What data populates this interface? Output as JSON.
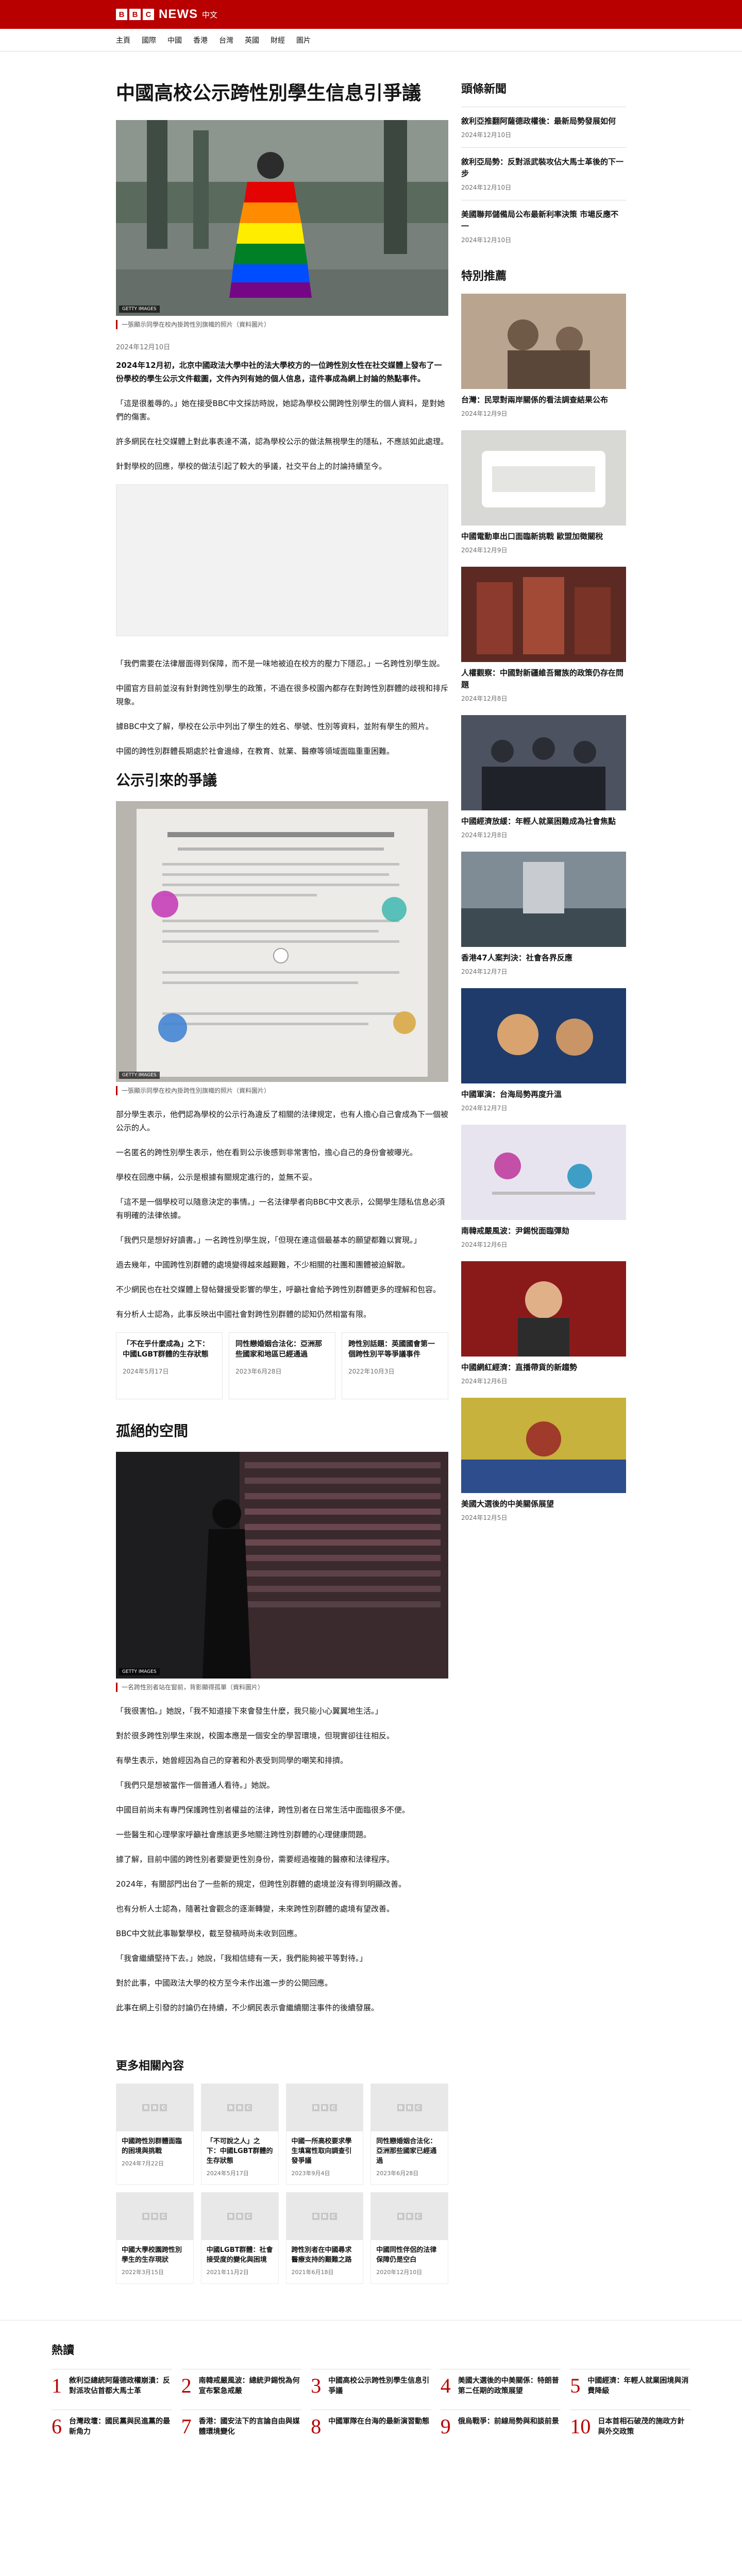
{
  "header": {
    "logo_letters": [
      "B",
      "B",
      "C"
    ],
    "news": "NEWS",
    "lang": "中文",
    "nav": [
      "主頁",
      "國際",
      "中國",
      "香港",
      "台灣",
      "英國",
      "財經",
      "圖片"
    ]
  },
  "article": {
    "title": "中國高校公示跨性別學生信息引爭議",
    "hero_caption": "一張顯示同學在校內掛跨性別旗幟的照片（資料圖片）",
    "byline": "2024年12月10日",
    "paragraphs": [
      "2024年12月初，北京中國政法大學中社的法大學校方的一位跨性別女性在社交媒體上發布了一份學校的學生公示文件截圖，文件內列有她的個人信息，這件事成為網上討論的熱點事件。",
      "「這是很羞辱的。」她在接受BBC中文採訪時說，她認為學校公開跨性別學生的個人資料，是對她們的傷害。",
      "許多網民在社交媒體上對此事表達不滿，認為學校公示的做法無視學生的隱私，不應該如此處理。",
      "針對學校的回應，學校的做法引起了較大的爭議，社交平台上的討論持續至今。",
      "「我們需要在法律層面得到保障，而不是一味地被迫在校方的壓力下隱忍。」一名跨性別學生說。",
      "中國官方目前並沒有針對跨性別學生的政策，不過在很多校園內都存在對跨性別群體的歧視和排斥現象。",
      "據BBC中文了解，學校在公示中列出了學生的姓名、學號、性別等資料，並附有學生的照片。",
      "中國的跨性別群體長期處於社會邊緣，在教育、就業、醫療等領域面臨重重困難。"
    ],
    "section_heading": "公示引來的爭議",
    "paragraphs2": [
      "部分學生表示，他們認為學校的公示行為違反了相關的法律規定，也有人擔心自己會成為下一個被公示的人。",
      "一名匿名的跨性別學生表示，他在看到公示後感到非常害怕，擔心自己的身份會被曝光。",
      "學校在回應中稱，公示是根據有關規定進行的，並無不妥。",
      "「這不是一個學校可以隨意決定的事情。」一名法律學者向BBC中文表示，公開學生隱私信息必須有明確的法律依據。",
      "「我們只是想好好讀書。」一名跨性別學生說，「但現在連這個最基本的願望都難以實現。」",
      "過去幾年，中國跨性別群體的處境變得越來越艱難，不少相關的社團和團體被迫解散。",
      "不少網民也在社交媒體上發帖聲援受影響的學生，呼籲社會給予跨性別群體更多的理解和包容。",
      "有分析人士認為，此事反映出中國社會對跨性別群體的認知仍然相當有限。"
    ],
    "inline_cards": [
      {
        "title": "「不在乎什麼成為」之下：中國LGBT群體的生存狀態",
        "date": "2024年5月17日"
      },
      {
        "title": "同性戀婚姻合法化：亞洲那些國家和地區已經通過",
        "date": "2023年6月28日"
      },
      {
        "title": "跨性別話題：英國國會第一個跨性別平等爭議事件",
        "date": "2022年10月3日"
      }
    ],
    "section_heading2": "孤絕的空間",
    "photo2_caption": "一名跨性別者站在窗前，背影顯得孤單（資料圖片）",
    "paragraphs3": [
      "「我很害怕。」她說，「我不知道接下來會發生什麼，我只能小心翼翼地生活。」",
      "對於很多跨性別學生來說，校園本應是一個安全的學習環境，但現實卻往往相反。",
      "有學生表示，她曾經因為自己的穿著和外表受到同學的嘲笑和排擠。",
      "「我們只是想被當作一個普通人看待。」她說。",
      "中國目前尚未有專門保護跨性別者權益的法律，跨性別者在日常生活中面臨很多不便。",
      "一些醫生和心理學家呼籲社會應該更多地關注跨性別群體的心理健康問題。",
      "據了解，目前中國的跨性別者要變更性別身份，需要經過複雜的醫療和法律程序。",
      "2024年，有關部門出台了一些新的規定，但跨性別群體的處境並沒有得到明顯改善。",
      "也有分析人士認為，隨著社會觀念的逐漸轉變，未來跨性別群體的處境有望改善。",
      "BBC中文就此事聯繫學校，截至發稿時尚未收到回應。",
      "「我會繼續堅持下去。」她說，「我相信總有一天，我們能夠被平等對待。」",
      "對於此事，中國政法大學的校方至今未作出進一步的公開回應。",
      "此事在網上引發的討論仍在持續，不少網民表示會繼續關注事件的後續發展。"
    ]
  },
  "sidebar": {
    "title": "頭條新聞",
    "top": [
      {
        "title": "敘利亞推翻阿薩德政權後：最新局勢發展如何",
        "date": "2024年12月10日"
      },
      {
        "title": "敘利亞局勢：反對派武裝攻佔大馬士革後的下一步",
        "date": "2024年12月10日"
      },
      {
        "title": "美國聯邦儲備局公布最新利率決策 市場反應不一",
        "date": "2024年12月10日"
      }
    ],
    "featured_title": "特別推薦",
    "featured": [
      {
        "title": "台灣：民眾對兩岸關係的看法調查結果公布",
        "date": "2024年12月9日"
      },
      {
        "title": "中國電動車出口面臨新挑戰 歐盟加徵關稅",
        "date": "2024年12月9日"
      },
      {
        "title": "人權觀察：中國對新疆維吾爾族的政策仍存在問題",
        "date": "2024年12月8日"
      },
      {
        "title": "中國經濟放緩：年輕人就業困難成為社會焦點",
        "date": "2024年12月8日"
      },
      {
        "title": "香港47人案判決：社會各界反應",
        "date": "2024年12月7日"
      },
      {
        "title": "中國軍演：台海局勢再度升溫",
        "date": "2024年12月7日"
      },
      {
        "title": "南韓戒嚴風波：尹錫悅面臨彈劾",
        "date": "2024年12月6日"
      },
      {
        "title": "中國網紅經濟：直播帶貨的新趨勢",
        "date": "2024年12月6日"
      },
      {
        "title": "美國大選後的中美關係展望",
        "date": "2024年12月5日"
      }
    ]
  },
  "more": {
    "title": "更多相關內容",
    "items": [
      {
        "title": "中國跨性別群體面臨的困境與挑戰",
        "date": "2024年7月22日"
      },
      {
        "title": "「不可說之人」之下：中國LGBT群體的生存狀態",
        "date": "2024年5月17日"
      },
      {
        "title": "中國一所高校要求學生填寫性取向調查引發爭議",
        "date": "2023年9月4日"
      },
      {
        "title": "同性戀婚姻合法化：亞洲那些國家已經通過",
        "date": "2023年6月28日"
      },
      {
        "title": "中國大學校園跨性別學生的生存現狀",
        "date": "2022年3月15日"
      },
      {
        "title": "中國LGBT群體：社會接受度的變化與困境",
        "date": "2021年11月2日"
      },
      {
        "title": "跨性別者在中國尋求醫療支持的艱難之路",
        "date": "2021年6月18日"
      },
      {
        "title": "中國同性伴侶的法律保障仍是空白",
        "date": "2020年12月10日"
      }
    ]
  },
  "popular": {
    "title": "熱讀",
    "items": [
      "敘利亞總統阿薩德政權崩潰：反對派攻佔首都大馬士革",
      "南韓戒嚴風波：總統尹錫悅為何宣布緊急戒嚴",
      "中國高校公示跨性別學生信息引爭議",
      "美國大選後的中美關係：特朗普第二任期的政策展望",
      "中國經濟：年輕人就業困境與消費降級",
      "台灣政壇：國民黨與民進黨的最新角力",
      "香港：國安法下的言論自由與媒體環境變化",
      "中國軍隊在台海的最新演習動態",
      "俄烏戰爭：前線局勢與和談前景",
      "日本首相石破茂的施政方針與外交政策"
    ]
  }
}
